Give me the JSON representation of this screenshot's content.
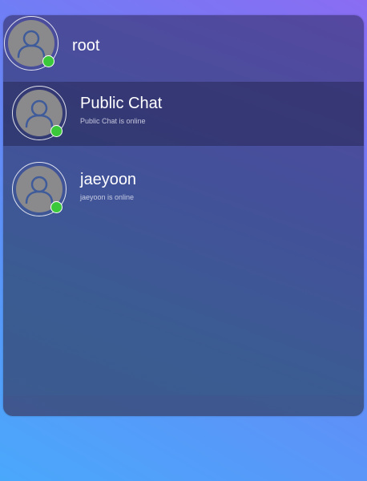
{
  "current_user": {
    "name": "root",
    "online": true,
    "avatar_icon": "user-avatar-icon"
  },
  "contacts": [
    {
      "name": "Public Chat",
      "status": "Public Chat is online",
      "online": true,
      "active": true
    },
    {
      "name": "jaeyoon",
      "status": "jaeyoon is online",
      "online": true,
      "active": false
    }
  ],
  "colors": {
    "online": "#3bc93b",
    "avatar_bg": "#8a8a8c",
    "avatar_glyph": "#3f5b9a",
    "active_row": "#2d2d5a"
  }
}
